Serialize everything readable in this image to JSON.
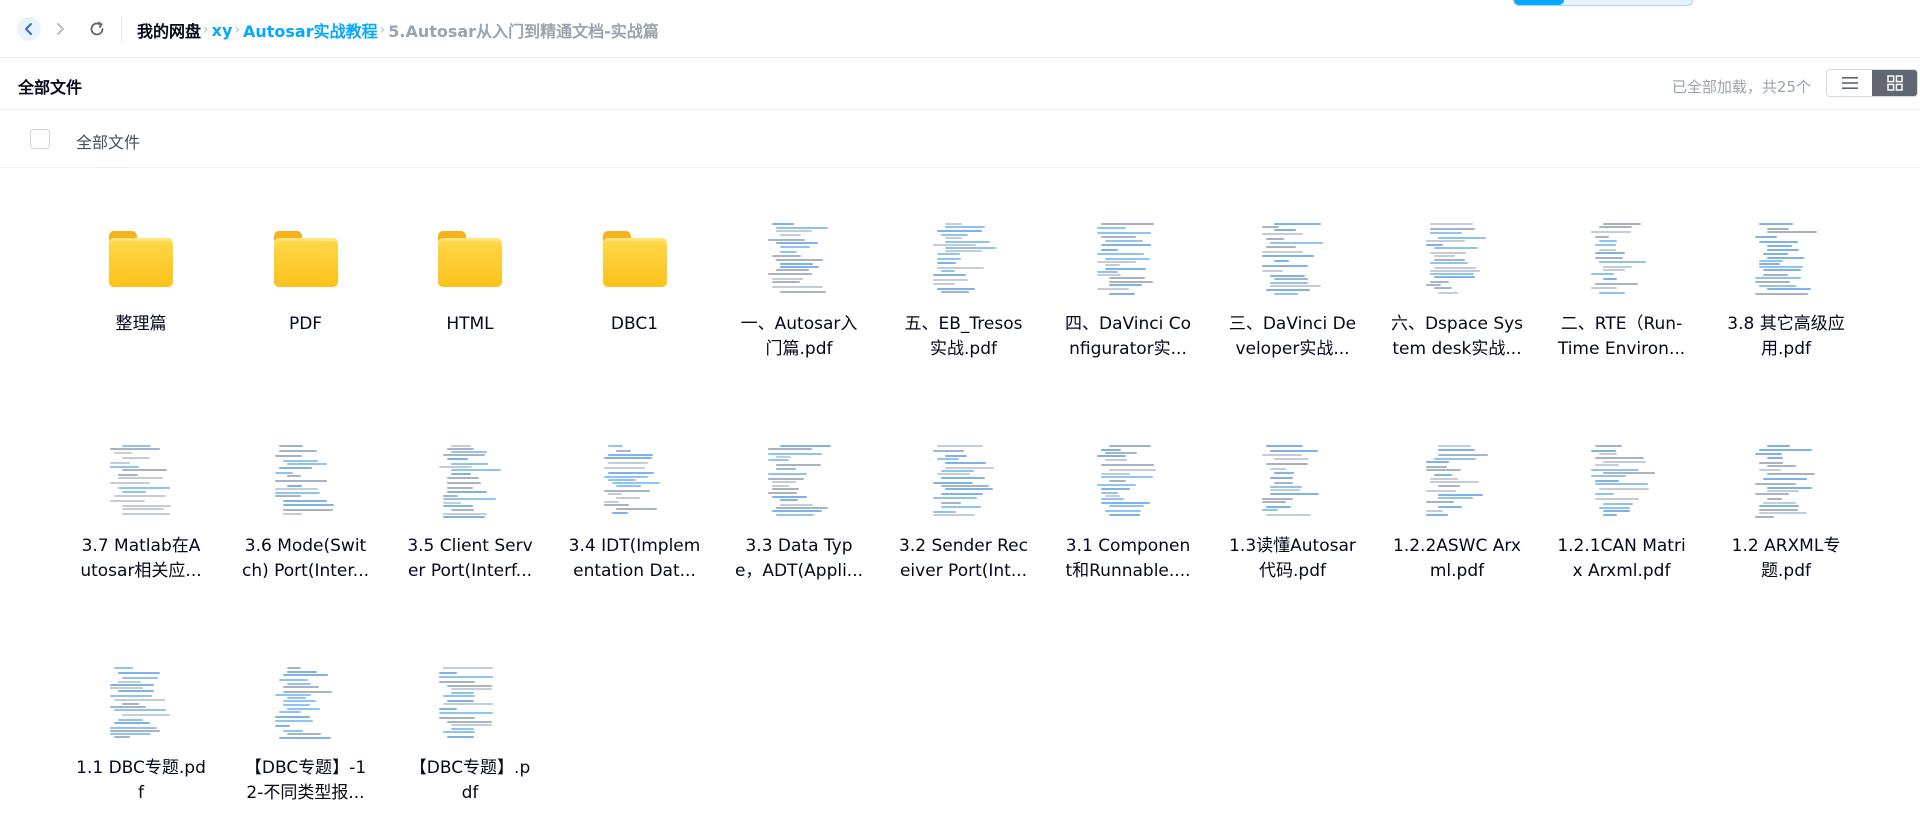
{
  "nav": {
    "back_icon": "chevron-left-icon",
    "forward_icon": "chevron-right-icon",
    "refresh_icon": "refresh-icon"
  },
  "breadcrumb": [
    {
      "label": "我的网盘",
      "kind": "root"
    },
    {
      "label": "xy",
      "kind": "link"
    },
    {
      "label": "Autosar实战教程",
      "kind": "link"
    },
    {
      "label": "5.Autosar从入门到精通文档-实战篇",
      "kind": "current"
    }
  ],
  "breadcrumb_separator": "›",
  "title_row": {
    "title": "全部文件",
    "status": "已全部加载，共25个",
    "view_list_icon": "list-view-icon",
    "view_grid_icon": "grid-view-icon",
    "active_view": "grid"
  },
  "list_header": {
    "label": "全部文件"
  },
  "colors": {
    "accent": "#06a7ff",
    "folder": "#fcc21b",
    "text": "#03081a",
    "muted": "#9ba3b0"
  },
  "files": [
    {
      "type": "folder",
      "line1": "整理篇",
      "line2": ""
    },
    {
      "type": "folder",
      "line1": "PDF",
      "line2": ""
    },
    {
      "type": "folder",
      "line1": "HTML",
      "line2": ""
    },
    {
      "type": "folder",
      "line1": "DBC1",
      "line2": ""
    },
    {
      "type": "pdf",
      "line1": "一、Autosar入",
      "line2": "门篇.pdf"
    },
    {
      "type": "pdf",
      "line1": "五、EB_Tresos",
      "line2": "实战.pdf"
    },
    {
      "type": "pdf",
      "line1": "四、DaVinci Co",
      "line2": "nfigurator实..."
    },
    {
      "type": "pdf",
      "line1": "三、DaVinci De",
      "line2": "veloper实战..."
    },
    {
      "type": "pdf",
      "line1": "六、Dspace Sys",
      "line2": "tem desk实战..."
    },
    {
      "type": "pdf",
      "line1": "二、RTE（Run-",
      "line2": "Time Environ..."
    },
    {
      "type": "pdf",
      "line1": "3.8 其它高级应",
      "line2": "用.pdf"
    },
    {
      "type": "pdf",
      "line1": "3.7 Matlab在A",
      "line2": "utosar相关应..."
    },
    {
      "type": "pdf",
      "line1": "3.6 Mode(Swit",
      "line2": "ch) Port(Inter..."
    },
    {
      "type": "pdf",
      "line1": "3.5 Client Serv",
      "line2": "er Port(Interf..."
    },
    {
      "type": "pdf",
      "line1": "3.4 IDT(Implem",
      "line2": "entation Dat..."
    },
    {
      "type": "pdf",
      "line1": "3.3 Data Typ",
      "line2": "e，ADT(Appli..."
    },
    {
      "type": "pdf",
      "line1": "3.2 Sender Rec",
      "line2": "eiver Port(Int..."
    },
    {
      "type": "pdf",
      "line1": "3.1 Componen",
      "line2": "t和Runnable...."
    },
    {
      "type": "pdf",
      "line1": "1.3读懂Autosar",
      "line2": "代码.pdf"
    },
    {
      "type": "pdf",
      "line1": "1.2.2ASWC Arx",
      "line2": "ml.pdf"
    },
    {
      "type": "pdf",
      "line1": "1.2.1CAN Matri",
      "line2": "x Arxml.pdf"
    },
    {
      "type": "pdf",
      "line1": "1.2 ARXML专",
      "line2": "题.pdf"
    },
    {
      "type": "pdf",
      "line1": "1.1 DBC专题.pd",
      "line2": "f"
    },
    {
      "type": "pdf",
      "line1": "【DBC专题】-1",
      "line2": "2-不同类型报..."
    },
    {
      "type": "pdf",
      "line1": "【DBC专题】.p",
      "line2": "df"
    }
  ]
}
